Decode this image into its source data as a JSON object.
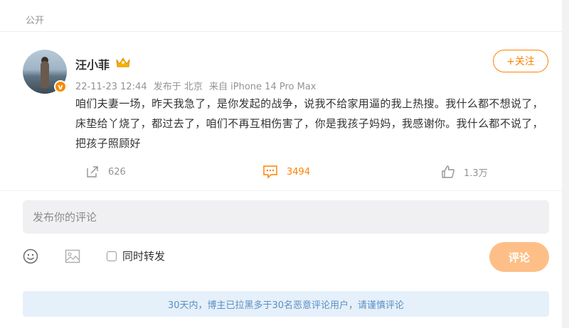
{
  "post": {
    "visibility": "公开",
    "author": {
      "name": "汪小菲",
      "badge": "v"
    },
    "meta": {
      "date": "22-11-23 12:44",
      "location": "发布于 北京",
      "source": "来自 iPhone 14 Pro Max"
    },
    "follow_label": "+关注",
    "content": "咱们夫妻一场，昨天我急了，是你发起的战争，说我不给家用逼的我上热搜。我什么都不想说了，床垫给丫烧了，都过去了，咱们不再互相伤害了，你是我孩子妈妈，我感谢你。我什么都不说了，把孩子照顾好",
    "actions": {
      "repost_count": "626",
      "comment_count": "3494",
      "like_count": "1.3万"
    }
  },
  "comment_box": {
    "placeholder": "发布你的评论",
    "repost_label": "同时转发",
    "submit_label": "评论"
  },
  "notice": "30天内，博主已拉黑多于30名恶意评论用户，请谨慎评论",
  "colors": {
    "accent": "#ff8200",
    "submit_disabled": "#fdbf87",
    "notice_bg": "#e5f0fa",
    "notice_text": "#5b8fc2"
  }
}
